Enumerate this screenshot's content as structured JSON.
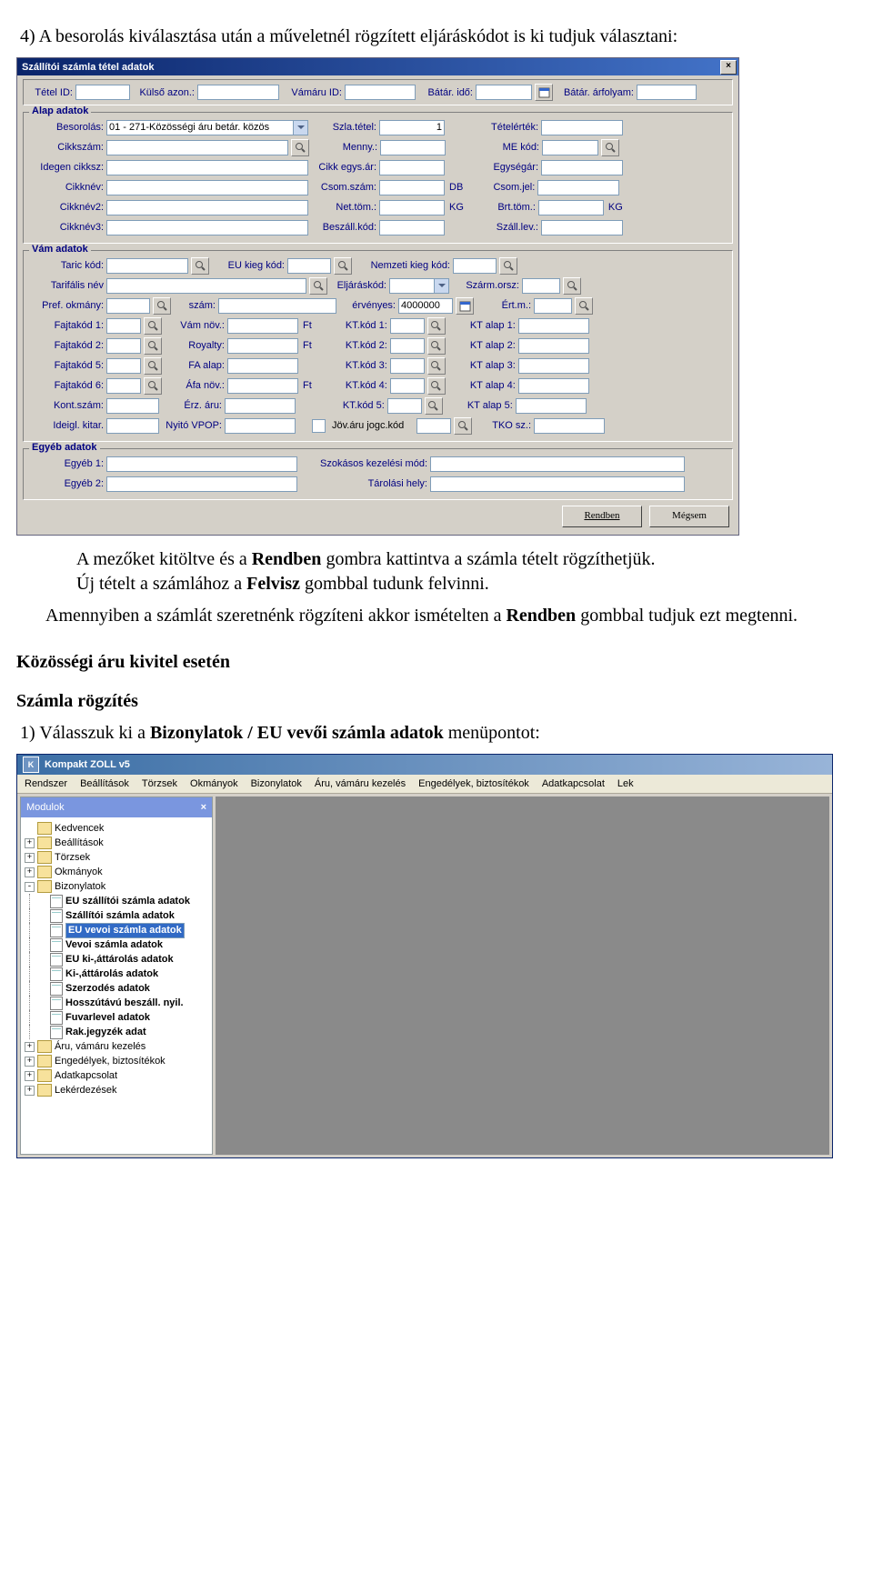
{
  "intro": {
    "num": "4)",
    "text": "A besorolás kiválasztása után a műveletnél rögzített eljáráskódot is ki tudjuk választani:"
  },
  "form": {
    "title": "Szállítói számla tétel adatok",
    "header": {
      "tetel_id": "Tétel ID:",
      "kulso_azon": "Külső azon.:",
      "vamaru_id": "Vámáru ID:",
      "batar_ido": "Bátár. idő:",
      "batar_arfolyam": "Bátár. árfolyam:"
    },
    "alap": {
      "title": "Alap adatok",
      "besorolas": "Besorolás:",
      "besorolas_val": "01 - 271-Közösségi áru betár. közös",
      "szlatetel": "Szla.tétel:",
      "szlatetel_val": "1",
      "tetelertek": "Tételérték:",
      "cikkszam": "Cikkszám:",
      "menny": "Menny.:",
      "mekod": "ME kód:",
      "idegen": "Idegen cikksz:",
      "cikkegysar": "Cikk egys.ár:",
      "egysegar": "Egységár:",
      "cikknev": "Cikknév:",
      "csomszam": "Csom.szám:",
      "db": "DB",
      "csomjel": "Csom.jel:",
      "cikknev2": "Cikknév2:",
      "nettom": "Net.töm.:",
      "kg": "KG",
      "brttom": "Brt.töm.:",
      "cikknev3": "Cikknév3:",
      "beszallkod": "Beszáll.kód:",
      "szalllev": "Száll.lev.:"
    },
    "vam": {
      "title": "Vám adatok",
      "taric": "Taric kód:",
      "eukieg": "EU kieg kód:",
      "nemzeti": "Nemzeti kieg kód:",
      "tarifalis": "Tarifális név",
      "eljaraskod": "Eljáráskód:",
      "szarmorsz": "Szárm.orsz:",
      "prefokmany": "Pref. okmány:",
      "szam": "szám:",
      "ervenyes": "érvényes:",
      "ervenyes_val": "4000000",
      "ertm": "Ért.m.:",
      "fajtakod1": "Fajtakód 1:",
      "fajtakod2": "Fajtakód 2:",
      "fajtakod5": "Fajtakód 5:",
      "fajtakod6": "Fajtakód 6:",
      "vamnov": "Vám növ.:",
      "royalty": "Royalty:",
      "faalap": "FA alap:",
      "afanov": "Áfa növ.:",
      "ft": "Ft",
      "ktkod1": "KT.kód 1:",
      "ktkod2": "KT.kód 2:",
      "ktkod3": "KT.kód 3:",
      "ktkod4": "KT.kód 4:",
      "ktkod5": "KT.kód 5:",
      "ktalap1": "KT alap 1:",
      "ktalap2": "KT alap 2:",
      "ktalap3": "KT alap 3:",
      "ktalap4": "KT alap 4:",
      "ktalap5": "KT alap 5:",
      "kontszam": "Kont.szám:",
      "erzaru": "Érz. áru:",
      "ideiglkitar": "Ideigl. kitar.",
      "nyitovpop": "Nyitó VPOP:",
      "jovaru": "Jöv.áru jogc.kód",
      "tkosz": "TKO sz.:"
    },
    "egyeb": {
      "title": "Egyéb adatok",
      "egyeb1": "Egyéb 1:",
      "egyeb2": "Egyéb 2:",
      "szokasos": "Szokásos kezelési mód:",
      "tarolasi": "Tárolási hely:"
    },
    "buttons": {
      "rendben": "Rendben",
      "megsem": "Mégsem"
    }
  },
  "para1_a": "A mezőket kitöltve és a ",
  "para1_b": "Rendben",
  "para1_c": " gombra kattintva a számla tételt rögzíthetjük.",
  "para2_a": "Új tételt a számlához a ",
  "para2_b": "Felvisz",
  "para2_c": " gombbal tudunk felvinni.",
  "para3_a": "Amennyiben a számlát szeretnénk rögzíteni akkor ismételten a ",
  "para3_b": "Rendben",
  "para3_c": " gombbal tudjuk ezt megtenni.",
  "h2": "Közösségi áru kivitel esetén",
  "h3": "Számla rögzítés",
  "list1_num": "1)",
  "list1_a": "Válasszuk ki a ",
  "list1_b": "Bizonylatok / EU vevői számla adatok",
  "list1_c": " menüpontot:",
  "app": {
    "title": "Kompakt ZOLL v5",
    "menu": [
      "Rendszer",
      "Beállítások",
      "Törzsek",
      "Okmányok",
      "Bizonylatok",
      "Áru, vámáru kezelés",
      "Engedélyek, biztosítékok",
      "Adatkapcsolat",
      "Lek"
    ],
    "mod_title": "Modulok",
    "tree": {
      "kedvencek": "Kedvencek",
      "beallitasok": "Beállítások",
      "torzsek": "Törzsek",
      "okmanyok": "Okmányok",
      "bizonylatok": "Bizonylatok",
      "b1": "EU szállítói számla adatok",
      "b2": "Szállítói számla adatok",
      "b3": "EU vevoi számla adatok",
      "b4": "Vevoi számla adatok",
      "b5": "EU ki-,áttárolás adatok",
      "b6": "Ki-,áttárolás adatok",
      "b7": "Szerzodés adatok",
      "b8": "Hosszútávú beszáll. nyil.",
      "b9": "Fuvarlevel adatok",
      "b10": "Rak.jegyzék adat",
      "aru": "Áru, vámáru kezelés",
      "eng": "Engedélyek, biztosítékok",
      "adat": "Adatkapcsolat",
      "lek": "Lekérdezések"
    }
  }
}
